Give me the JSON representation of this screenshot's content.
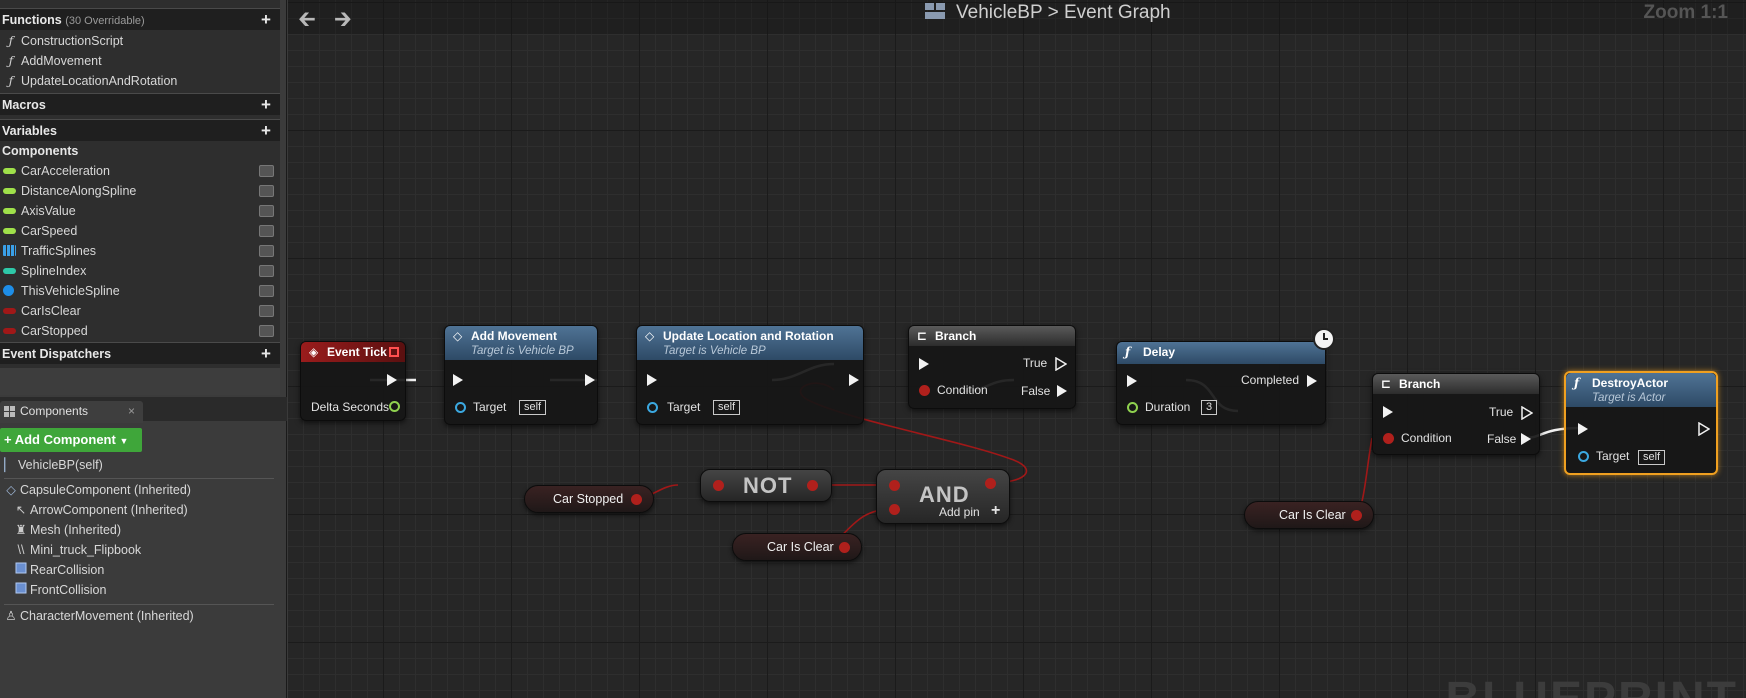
{
  "left_panel": {
    "functions": {
      "title": "Functions",
      "sub": "(30 Overridable)",
      "add": "+",
      "items": [
        {
          "label": "ConstructionScript",
          "icon": "construction-function-icon"
        },
        {
          "label": "AddMovement",
          "icon": "function-icon"
        },
        {
          "label": "UpdateLocationAndRotation",
          "icon": "function-icon"
        }
      ]
    },
    "macros": {
      "title": "Macros",
      "add": "+"
    },
    "variables": {
      "title": "Variables",
      "add": "+"
    },
    "components_label": "Components",
    "variable_items": [
      {
        "label": "CarAcceleration",
        "color": "#9fe04a"
      },
      {
        "label": "DistanceAlongSpline",
        "color": "#9fe04a"
      },
      {
        "label": "AxisValue",
        "color": "#9fe04a"
      },
      {
        "label": "CarSpeed",
        "color": "#9fe04a"
      },
      {
        "label": "TrafficSplines",
        "color": "#3aa0e8",
        "array": true
      },
      {
        "label": "SplineIndex",
        "color": "#2ec8a8"
      },
      {
        "label": "ThisVehicleSpline",
        "color": "#1e8ee8",
        "round": true
      },
      {
        "label": "CarIsClear",
        "color": "#a01818"
      },
      {
        "label": "CarStopped",
        "color": "#a01818"
      }
    ],
    "event_dispatchers": {
      "title": "Event Dispatchers",
      "add": "+"
    },
    "components_tab": {
      "label": "Components",
      "close": "×"
    },
    "add_component": "+ Add Component",
    "tree": [
      {
        "label": "VehicleBP(self)",
        "icon": "actor-icon"
      },
      {
        "label": "CapsuleComponent (Inherited)",
        "icon": "capsule-icon"
      },
      {
        "label": "ArrowComponent (Inherited)",
        "icon": "arrow-component-icon"
      },
      {
        "label": "Mesh (Inherited)",
        "icon": "mesh-icon"
      },
      {
        "label": "Mini_truck_Flipbook",
        "icon": "flipbook-icon"
      },
      {
        "label": "RearCollision",
        "icon": "collision-box-icon"
      },
      {
        "label": "FrontCollision",
        "icon": "collision-box-icon"
      },
      {
        "label": "CharacterMovement (Inherited)",
        "icon": "character-movement-icon"
      }
    ]
  },
  "graph": {
    "breadcrumb": {
      "blueprint": "VehicleBP",
      "separator": ">",
      "graph": "Event Graph"
    },
    "zoom": "Zoom 1:1",
    "watermark": "BLUEPRINT",
    "nodes": {
      "event_tick": {
        "title": "Event Tick",
        "pin": "Delta Seconds",
        "color": "#8b1a1a"
      },
      "add_movement": {
        "title": "Add Movement",
        "subtitle": "Target is Vehicle BP",
        "target": "Target",
        "self": "self"
      },
      "update_loc": {
        "title": "Update Location and Rotation",
        "subtitle": "Target is Vehicle BP",
        "target": "Target",
        "self": "self"
      },
      "branch1": {
        "title": "Branch",
        "true": "True",
        "false": "False",
        "condition": "Condition"
      },
      "delay": {
        "title": "Delay",
        "completed": "Completed",
        "duration": "Duration",
        "duration_value": "3"
      },
      "branch2": {
        "title": "Branch",
        "true": "True",
        "false": "False",
        "condition": "Condition"
      },
      "destroy": {
        "title": "DestroyActor",
        "subtitle": "Target is Actor",
        "target": "Target",
        "self": "self"
      },
      "car_stopped": "Car Stopped",
      "not": "NOT",
      "and": "AND",
      "add_pin": "Add pin",
      "add_pin_plus": "+",
      "car_is_clear_1": "Car Is Clear",
      "car_is_clear_2": "Car Is Clear"
    }
  }
}
